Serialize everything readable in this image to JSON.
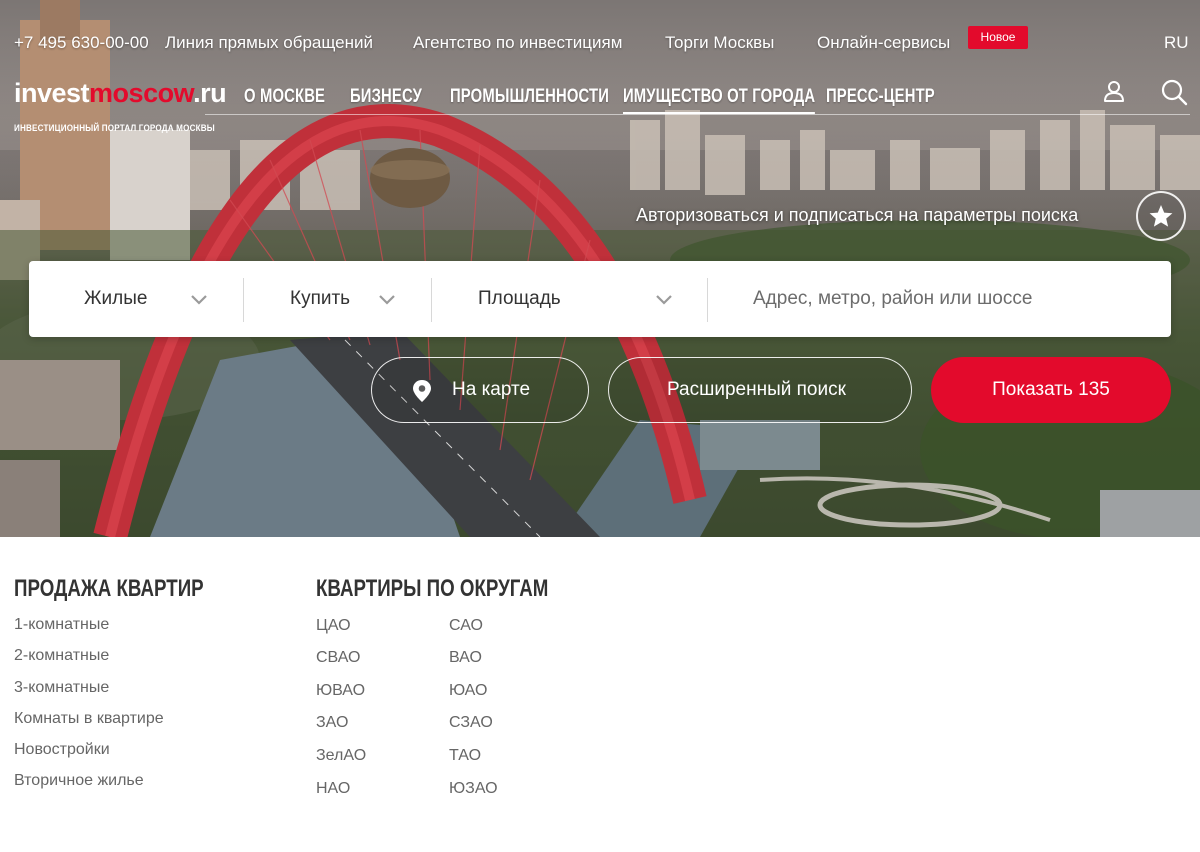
{
  "topbar": {
    "phone": "+7 495 630-00-00",
    "links": [
      "Линия прямых обращений",
      "Агентство по инвестициям",
      "Торги Москвы",
      "Онлайн-сервисы"
    ],
    "badge": "Новое",
    "lang": "RU"
  },
  "logo": {
    "part1": "invest",
    "part2": "moscow",
    "part3": ".ru",
    "tagline": "ИНВЕСТИЦИОННЫЙ ПОРТАЛ ГОРОДА МОСКВЫ"
  },
  "nav": {
    "items": [
      "О Москве",
      "Бизнесу",
      "Промышленности",
      "Имущество от города",
      "Пресс-центр"
    ],
    "active": "Имущество от города"
  },
  "subscribe": {
    "text": "Авторизоваться и подписаться на параметры поиска"
  },
  "search": {
    "type": "Жилые",
    "deal": "Купить",
    "area": "Площадь",
    "address_placeholder": "Адрес, метро, район или шоссе"
  },
  "actions": {
    "map": "На карте",
    "advanced": "Расширенный поиск",
    "show": "Показать 135"
  },
  "sections": {
    "sale": {
      "title": "Продажа квартир",
      "items": [
        "1-комнатные",
        "2-комнатные",
        "3-комнатные",
        "Комнаты в квартире",
        "Новостройки",
        "Вторичное жилье"
      ]
    },
    "districts": {
      "title": "Квартиры по округам",
      "col1": [
        "ЦАО",
        "СВАО",
        "ЮВАО",
        "ЗАО",
        "ЗелАО",
        "НАО"
      ],
      "col2": [
        "САО",
        "ВАО",
        "ЮАО",
        "СЗАО",
        "ТАО",
        "ЮЗАО"
      ]
    }
  },
  "colors": {
    "accent": "#e30a2c",
    "text": "#333333",
    "muted": "#666666"
  }
}
